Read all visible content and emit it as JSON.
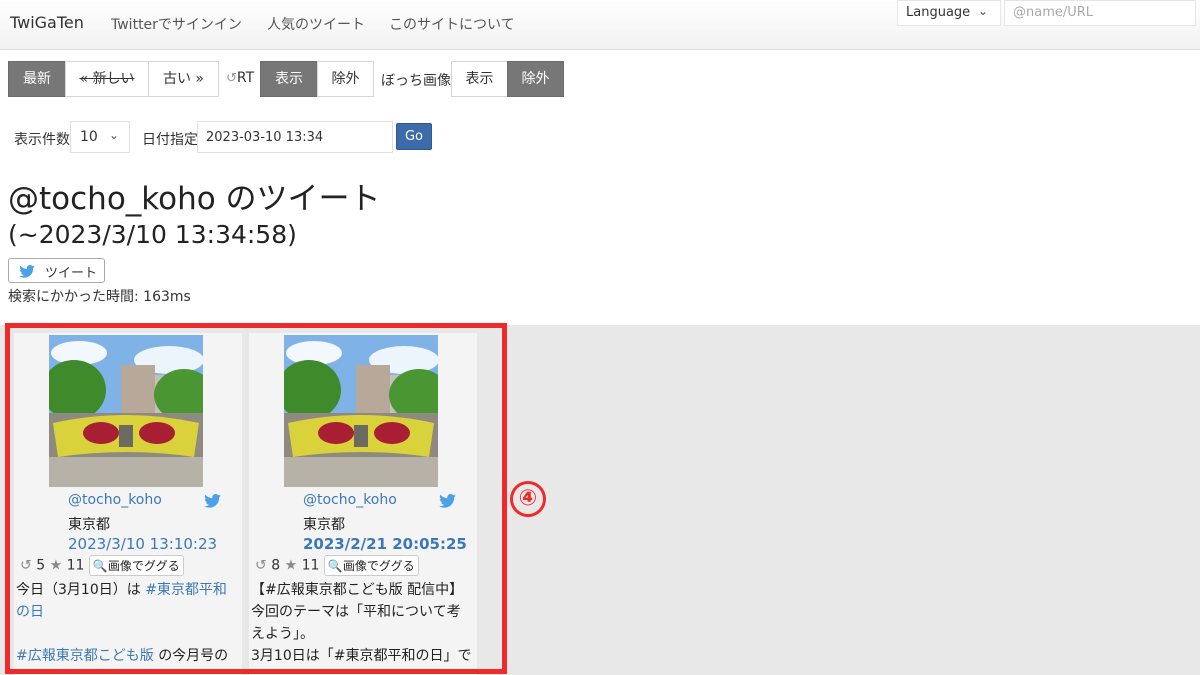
{
  "navbar": {
    "brand": "TwiGaTen",
    "links": [
      "Twitterでサインイン",
      "人気のツイート",
      "このサイトについて"
    ],
    "language_label": "Language",
    "search_placeholder": "@name/URL"
  },
  "controls": {
    "nav_buttons": [
      "最新",
      "« 新しい",
      "古い »"
    ],
    "rt_label": "RT",
    "rt_buttons": [
      "表示",
      "除外"
    ],
    "bocchi_label": "ぼっち画像",
    "bocchi_buttons": [
      "表示",
      "除外"
    ],
    "count_label": "表示件数",
    "count_value": "10",
    "date_label": "日付指定",
    "date_value": "2023-03-10 13:34",
    "go_label": "Go"
  },
  "header": {
    "title": "@tocho_koho のツイート",
    "subtitle": "(~2023/3/10 13:34:58)",
    "tweet_button": "ツイート",
    "search_time": "検索にかかった時間: 163ms"
  },
  "tweets": [
    {
      "handle": "@tocho_koho",
      "location": "東京都",
      "date": "2023/3/10 13:10:23",
      "retweets": "5",
      "likes": "11",
      "gugu_label": "画像でググる",
      "body": {
        "line1_prefix": "今日（3月10日）は",
        "line1_tag": "#東京都平和",
        "line2_tag": "の日",
        "line3_tag": "#広報東京都こども版",
        "line3_suffix": "の今月号の"
      }
    },
    {
      "handle": "@tocho_koho",
      "location": "東京都",
      "date": "2023/2/21 20:05:25",
      "retweets": "8",
      "likes": "11",
      "gugu_label": "画像でググる",
      "body": {
        "line1": "【#広報東京都こども版 配信中】",
        "line2": "今回のテーマは「平和について考",
        "line3": "えよう」。",
        "line4": "3月10日は「#東京都平和の日」で"
      }
    }
  ],
  "annotation": "④"
}
